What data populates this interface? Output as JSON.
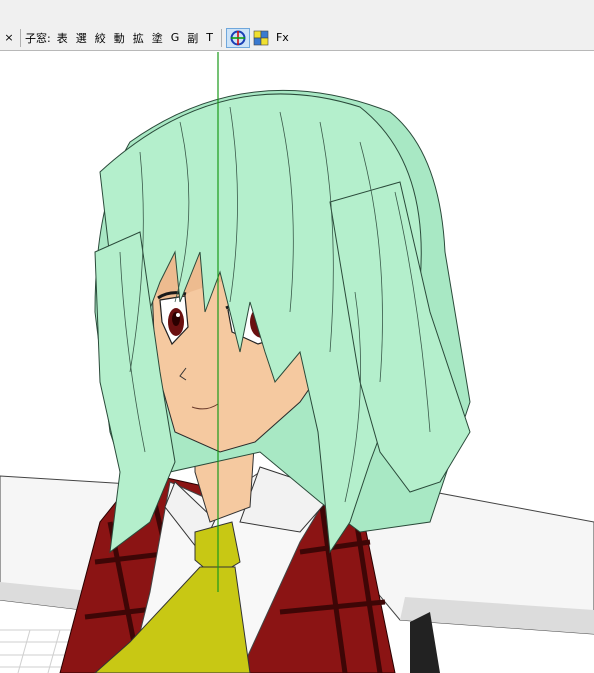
{
  "toolbar": {
    "close_label": "×",
    "subwindow_label": "子窓:",
    "buttons": [
      "表",
      "選",
      "絞",
      "動",
      "拡",
      "塗",
      "G",
      "副",
      "T"
    ],
    "icons": [
      {
        "name": "axis-target-icon",
        "active": true
      },
      {
        "name": "color-grid-icon",
        "active": false
      }
    ],
    "fx_label": "Fx"
  },
  "colors": {
    "hair": "#b4efcc",
    "skin": "#f5c9a0",
    "vest_red": "#8b1414",
    "plaid_dark": "#3e0606",
    "tie": "#c8c814",
    "shirt": "#f8f8f8",
    "guide_line": "#1a9a1a"
  }
}
